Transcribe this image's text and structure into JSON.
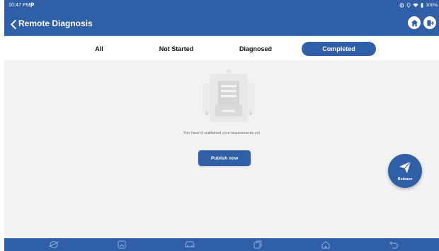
{
  "status_bar": {
    "time": "10:47 PM",
    "battery": "100%"
  },
  "header": {
    "title": "Remote Diagnosis"
  },
  "tabs": [
    {
      "label": "All",
      "active": false
    },
    {
      "label": "Not Started",
      "active": false
    },
    {
      "label": "Diagnosed",
      "active": false
    },
    {
      "label": "Completed",
      "active": true
    }
  ],
  "empty_state": {
    "message": "You haven't published your requirements yet"
  },
  "publish_button": {
    "label": "Publish now"
  },
  "release_button": {
    "label": "Release"
  },
  "bottom_nav": [
    "browser-icon",
    "gallery-icon",
    "car-icon",
    "recent-apps-icon",
    "home-icon",
    "back-icon"
  ],
  "colors": {
    "primary": "#2f5fa6",
    "background": "#f2f2f2",
    "text_muted": "#707070"
  }
}
